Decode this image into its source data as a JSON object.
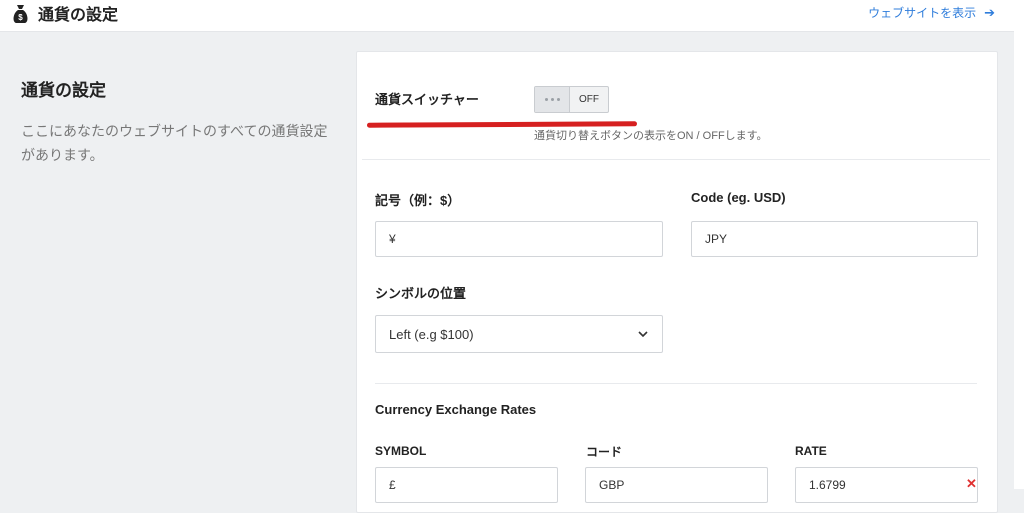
{
  "header": {
    "title": "通貨の設定",
    "icon": "money-bag-icon",
    "view_site_label": "ウェブサイトを表示",
    "view_site_icon": "arrow-right-icon"
  },
  "section": {
    "title": "通貨の設定",
    "description": "ここにあなたのウェブサイトのすべての通貨設定があります。"
  },
  "switcher": {
    "label": "通貨スイッチャー",
    "state": "OFF",
    "hint": "通貨切り替えボタンの表示をON / OFFします。"
  },
  "symbol_field": {
    "label": "記号（例：$）",
    "value": "¥"
  },
  "code_field": {
    "label": "Code (eg. USD)",
    "value": "JPY"
  },
  "position_field": {
    "label": "シンボルの位置",
    "value": "Left (e.g $100)"
  },
  "rates": {
    "title": "Currency Exchange Rates",
    "headers": {
      "symbol": "SYMBOL",
      "code": "コード",
      "rate": "RATE"
    },
    "rows": [
      {
        "symbol": "£",
        "code": "GBP",
        "rate": "1.6799"
      }
    ]
  },
  "colors": {
    "accent_link": "#2f7ddb",
    "highlight_underline": "#d62020",
    "remove_icon": "#e03030"
  }
}
